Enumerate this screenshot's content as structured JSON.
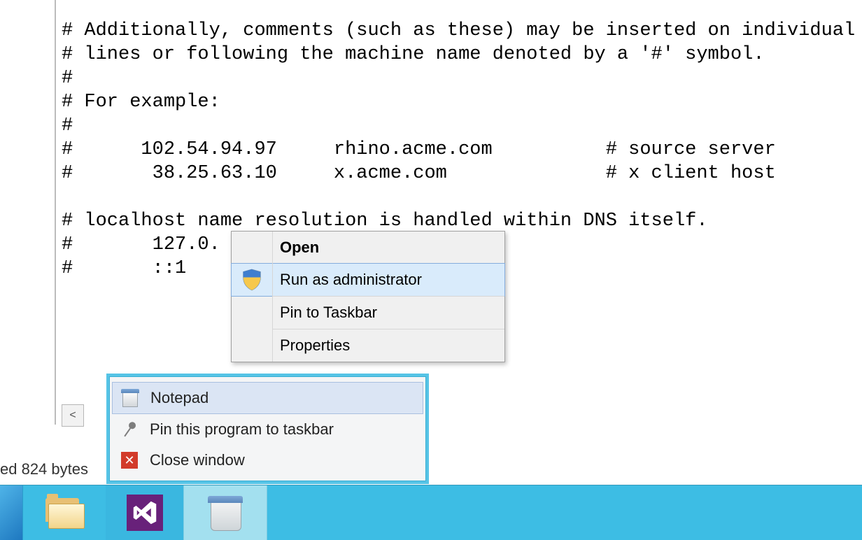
{
  "editor": {
    "lines": [
      "# Additionally, comments (such as these) may be inserted on individual",
      "# lines or following the machine name denoted by a '#' symbol.",
      "#",
      "# For example:",
      "#",
      "#      102.54.94.97     rhino.acme.com          # source server",
      "#       38.25.63.10     x.acme.com              # x client host",
      "",
      "# localhost name resolution is handled within DNS itself.",
      "#       127.0.",
      "#       ::1"
    ]
  },
  "scroll": {
    "left_glyph": "<"
  },
  "status": {
    "text": "ed  824 bytes"
  },
  "jumplist": {
    "app": "Notepad",
    "pin": "Pin this program to taskbar",
    "close": "Close window"
  },
  "context_menu": {
    "open": "Open",
    "run_admin": "Run as administrator",
    "pin_taskbar": "Pin to Taskbar",
    "properties": "Properties"
  },
  "taskbar": {
    "items": [
      "start",
      "explorer",
      "visual-studio",
      "notepad"
    ]
  }
}
